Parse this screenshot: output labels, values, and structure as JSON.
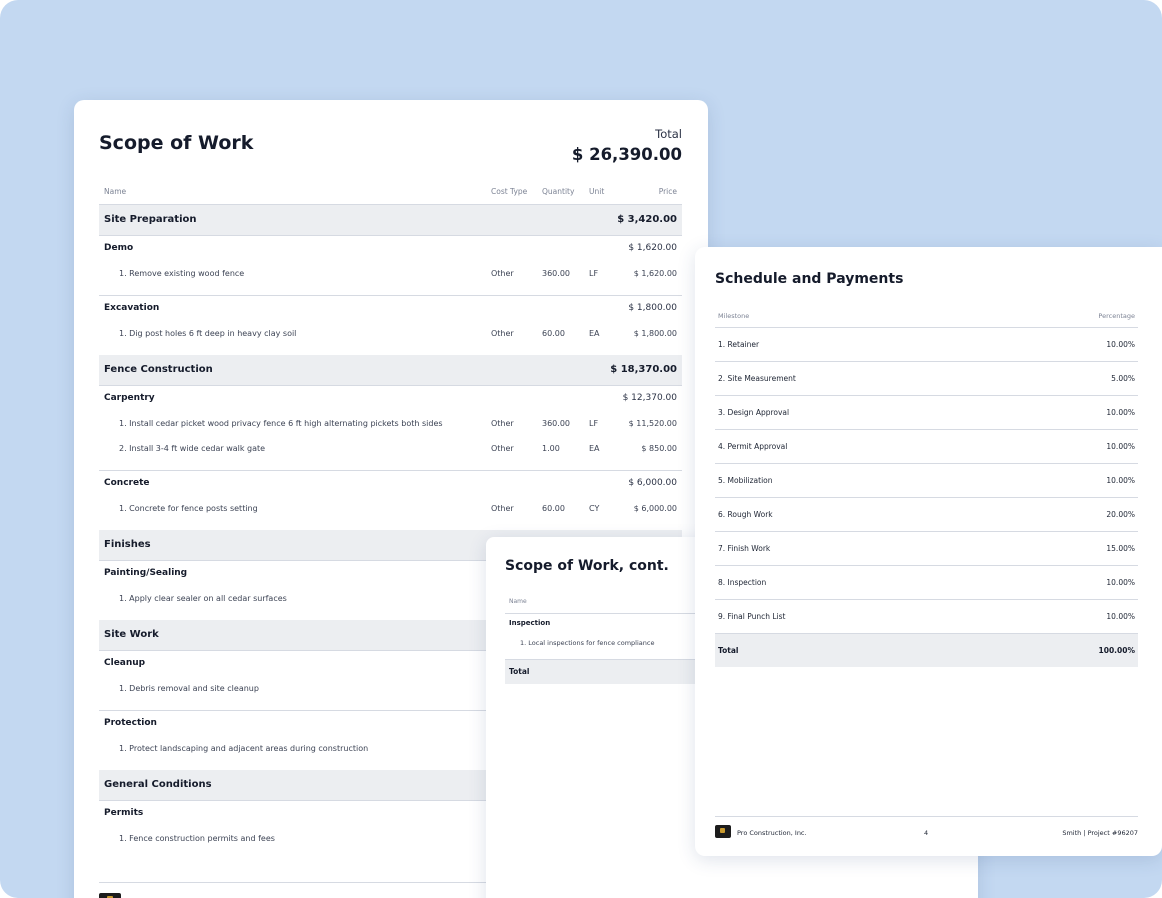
{
  "scope": {
    "title": "Scope of Work",
    "total_label": "Total",
    "total_value": "$ 26,390.00",
    "headers": {
      "name": "Name",
      "cost_type": "Cost Type",
      "quantity": "Quantity",
      "unit": "Unit",
      "price": "Price"
    },
    "sections": [
      {
        "name": "Site Preparation",
        "price": "$ 3,420.00",
        "groups": [
          {
            "name": "Demo",
            "price": "$ 1,620.00",
            "items": [
              {
                "name": "1. Remove existing wood fence",
                "cost_type": "Other",
                "quantity": "360.00",
                "unit": "LF",
                "price": "$ 1,620.00"
              }
            ]
          },
          {
            "name": "Excavation",
            "price": "$ 1,800.00",
            "items": [
              {
                "name": "1. Dig post holes 6 ft deep in heavy clay soil",
                "cost_type": "Other",
                "quantity": "60.00",
                "unit": "EA",
                "price": "$ 1,800.00"
              }
            ]
          }
        ]
      },
      {
        "name": "Fence Construction",
        "price": "$ 18,370.00",
        "groups": [
          {
            "name": "Carpentry",
            "price": "$ 12,370.00",
            "items": [
              {
                "name": "1. Install cedar picket wood privacy fence 6 ft high alternating pickets both sides",
                "cost_type": "Other",
                "quantity": "360.00",
                "unit": "LF",
                "price": "$ 11,520.00"
              },
              {
                "name": "2. Install 3-4 ft wide cedar walk gate",
                "cost_type": "Other",
                "quantity": "1.00",
                "unit": "EA",
                "price": "$ 850.00"
              }
            ]
          },
          {
            "name": "Concrete",
            "price": "$ 6,000.00",
            "items": [
              {
                "name": "1. Concrete for fence posts setting",
                "cost_type": "Other",
                "quantity": "60.00",
                "unit": "CY",
                "price": "$ 6,000.00"
              }
            ]
          }
        ]
      },
      {
        "name": "Finishes",
        "groups": [
          {
            "name": "Painting/Sealing",
            "items": [
              {
                "name": "1. Apply clear sealer on all cedar surfaces"
              }
            ]
          }
        ]
      },
      {
        "name": "Site Work",
        "groups": [
          {
            "name": "Cleanup",
            "items": [
              {
                "name": "1. Debris removal and site cleanup"
              }
            ]
          },
          {
            "name": "Protection",
            "items": [
              {
                "name": "1. Protect landscaping and adjacent areas during construction"
              }
            ]
          }
        ]
      },
      {
        "name": "General Conditions",
        "groups": [
          {
            "name": "Permits",
            "items": [
              {
                "name": "1. Fence construction permits and fees"
              }
            ]
          }
        ]
      }
    ]
  },
  "scope_cont": {
    "title": "Scope of Work, cont.",
    "header_name": "Name",
    "group": "Inspection",
    "item": "1. Local inspections for fence compliance",
    "total_label": "Total"
  },
  "schedule": {
    "title": "Schedule and Payments",
    "headers": {
      "milestone": "Milestone",
      "percentage": "Percentage"
    },
    "rows": [
      {
        "milestone": "1. Retainer",
        "percentage": "10.00%"
      },
      {
        "milestone": "2. Site Measurement",
        "percentage": "5.00%"
      },
      {
        "milestone": "3. Design Approval",
        "percentage": "10.00%"
      },
      {
        "milestone": "4. Permit Approval",
        "percentage": "10.00%"
      },
      {
        "milestone": "5. Mobilization",
        "percentage": "10.00%"
      },
      {
        "milestone": "6. Rough Work",
        "percentage": "20.00%"
      },
      {
        "milestone": "7. Finish Work",
        "percentage": "15.00%"
      },
      {
        "milestone": "8. Inspection",
        "percentage": "10.00%"
      },
      {
        "milestone": "9. Final Punch List",
        "percentage": "10.00%"
      }
    ],
    "total_label": "Total",
    "total_value": "100.00%",
    "footer": {
      "company": "Pro Construction, Inc.",
      "page": "4",
      "project": "Smith | Project #96207"
    }
  }
}
